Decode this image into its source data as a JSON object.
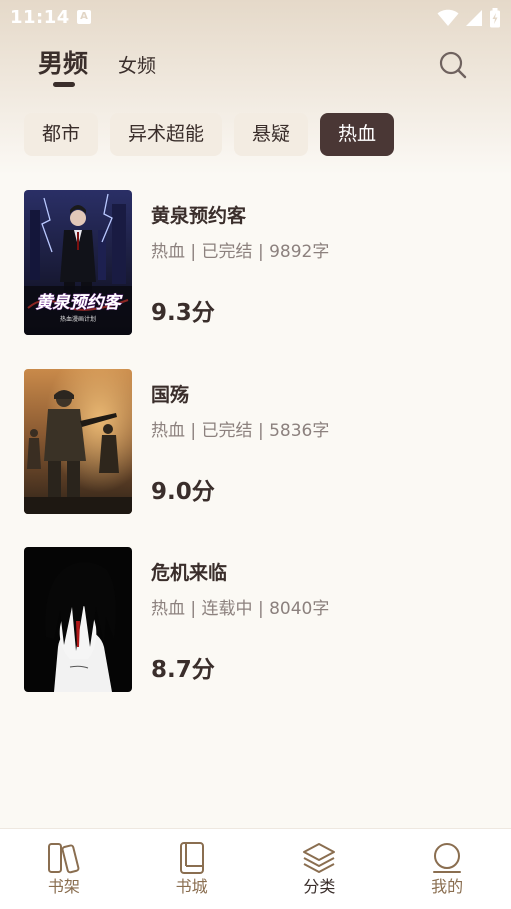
{
  "status_bar": {
    "time": "11:14",
    "notification_letter": "A"
  },
  "header": {
    "tabs": [
      {
        "label": "男频",
        "active": true
      },
      {
        "label": "女频",
        "active": false
      }
    ],
    "search_icon": "search-icon"
  },
  "categories": [
    {
      "label": "都市",
      "active": false
    },
    {
      "label": "异术超能",
      "active": false
    },
    {
      "label": "悬疑",
      "active": false
    },
    {
      "label": "热血",
      "active": true
    }
  ],
  "books": [
    {
      "title": "黄泉预约客",
      "meta": "热血 | 已完结 | 9892字",
      "score": "9.3分",
      "cover_text": "黄泉预约客",
      "cover_subtext": "热血漫画计划"
    },
    {
      "title": "国殇",
      "meta": "热血 | 已完结 | 5836字",
      "score": "9.0分"
    },
    {
      "title": "危机来临",
      "meta": "热血 | 连载中 | 8040字",
      "score": "8.7分"
    }
  ],
  "bottom_nav": [
    {
      "label": "书架",
      "icon": "bookshelf-icon",
      "active": false
    },
    {
      "label": "书城",
      "icon": "book-icon",
      "active": false
    },
    {
      "label": "分类",
      "icon": "layers-icon",
      "active": true
    },
    {
      "label": "我的",
      "icon": "profile-icon",
      "active": false
    }
  ],
  "colors": {
    "accent_dark": "#4a3735",
    "nav_icon": "#8a6e50",
    "meta_text": "#8c817e"
  }
}
